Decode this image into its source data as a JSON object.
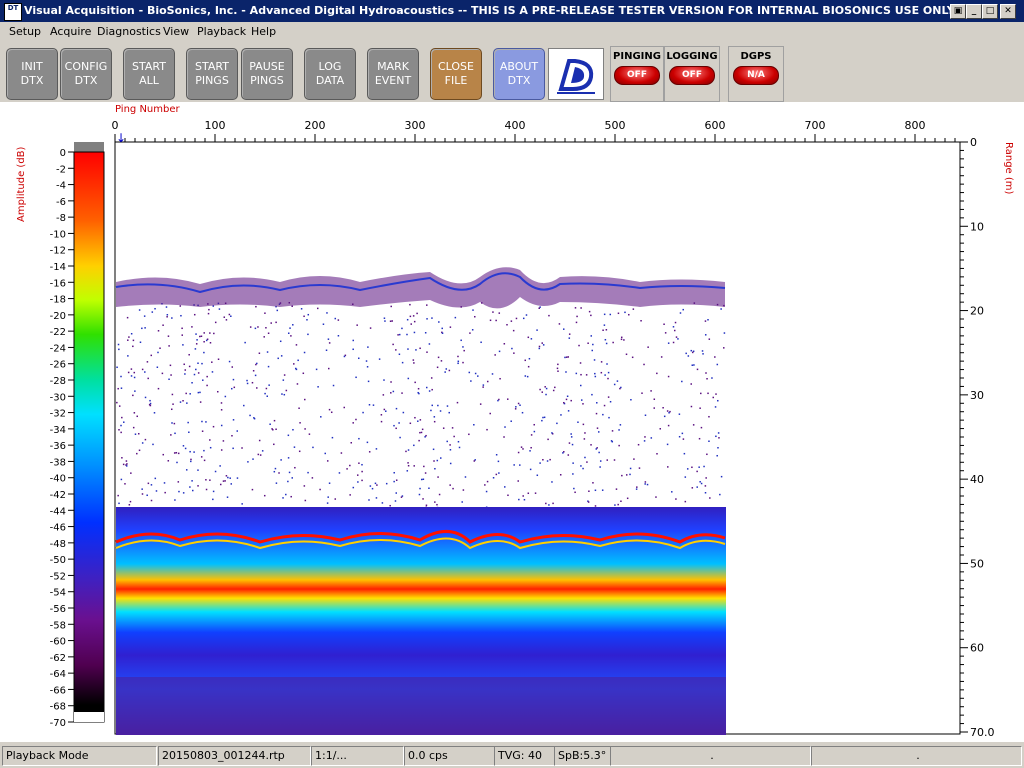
{
  "window": {
    "title": "Visual Acquisition  -  BioSonics, Inc.  -  Advanced Digital Hydroacoustics  -- THIS IS A PRE-RELEASE TESTER VERSION FOR INTERNAL BIOSONICS USE ONLY",
    "app_icon_text": "DT",
    "controls": [
      "restore",
      "minimize",
      "maximize",
      "close"
    ]
  },
  "menu": [
    "Setup",
    "Acquire",
    "Diagnostics",
    "View",
    "Playback",
    "Help"
  ],
  "toolbar": {
    "buttons": [
      {
        "label": "INIT\nDTX"
      },
      {
        "label": "CONFIG\nDTX"
      },
      {
        "label": "START\nALL"
      },
      {
        "label": "START\nPINGS"
      },
      {
        "label": "PAUSE\nPINGS"
      },
      {
        "label": "LOG\nDATA"
      },
      {
        "label": "MARK\nEVENT"
      },
      {
        "label": "CLOSE\nFILE"
      },
      {
        "label": "ABOUT\nDTX"
      }
    ],
    "indicators": [
      {
        "label": "PINGING",
        "state": "OFF"
      },
      {
        "label": "LOGGING",
        "state": "OFF"
      },
      {
        "label": "DGPS",
        "state": "N/A"
      }
    ]
  },
  "echogram": {
    "x_axis_title": "Ping Number",
    "x_ticks": [
      "0",
      "100",
      "200",
      "300",
      "400",
      "500",
      "600",
      "700",
      "800"
    ],
    "y_axis_title": "Range (m)",
    "y_ticks": [
      "0",
      "10",
      "20",
      "30",
      "40",
      "50",
      "60",
      "70.0"
    ],
    "colorbar_title": "Amplitude (dB)",
    "colorbar_ticks": [
      "0",
      "-2",
      "-4",
      "-6",
      "-8",
      "-10",
      "-12",
      "-14",
      "-16",
      "-18",
      "-20",
      "-22",
      "-24",
      "-26",
      "-28",
      "-30",
      "-32",
      "-34",
      "-36",
      "-38",
      "-40",
      "-42",
      "-44",
      "-46",
      "-48",
      "-50",
      "-52",
      "-54",
      "-56",
      "-58",
      "-60",
      "-62",
      "-64",
      "-66",
      "-68",
      "-70"
    ],
    "colors": {
      "axis_title": "#cc0000",
      "ping_marker": "#0000cc"
    }
  },
  "statusbar": {
    "mode": "Playback Mode",
    "file": "20150803_001244.rtp",
    "ratio": "1:1/...",
    "cps": "0.0 cps",
    "tvg": "TVG: 40",
    "spb": "SpB:5.3°",
    "extra1": ".",
    "extra2": "."
  }
}
